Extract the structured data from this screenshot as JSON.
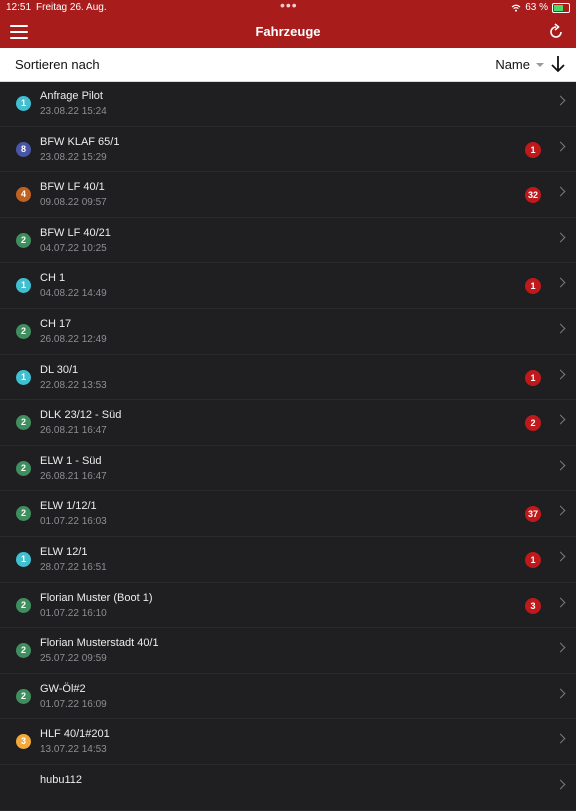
{
  "status": {
    "time": "12:51",
    "date": "Freitag 26. Aug.",
    "battery": "63 %",
    "battery_level": 0.63
  },
  "header": {
    "title": "Fahrzeuge",
    "menu_icon": "hamburger-menu-icon",
    "refresh_icon": "refresh-icon"
  },
  "sort": {
    "label": "Sortieren nach",
    "value": "Name",
    "direction_icon": "arrow-down-icon"
  },
  "colors": {
    "header": "#a81c1c",
    "badge": "#c0191c"
  },
  "vehicles": [
    {
      "count": "1",
      "color": "#3fbfd0",
      "name": "Anfrage Pilot",
      "time": "23.08.22 15:24",
      "badge": ""
    },
    {
      "count": "8",
      "color": "#4a55a8",
      "name": "BFW KLAF 65/1",
      "time": "23.08.22 15:29",
      "badge": "1"
    },
    {
      "count": "4",
      "color": "#c0621e",
      "name": "BFW LF 40/1",
      "time": "09.08.22 09:57",
      "badge": "32"
    },
    {
      "count": "2",
      "color": "#3e8e5e",
      "name": "BFW LF 40/21",
      "time": "04.07.22 10:25",
      "badge": ""
    },
    {
      "count": "1",
      "color": "#3fbfd0",
      "name": "CH 1",
      "time": "04.08.22 14:49",
      "badge": "1"
    },
    {
      "count": "2",
      "color": "#3e8e5e",
      "name": "CH 17",
      "time": "26.08.22 12:49",
      "badge": ""
    },
    {
      "count": "1",
      "color": "#3fbfd0",
      "name": "DL 30/1",
      "time": "22.08.22 13:53",
      "badge": "1"
    },
    {
      "count": "2",
      "color": "#3e8e5e",
      "name": "DLK 23/12 - Süd",
      "time": "26.08.21 16:47",
      "badge": "2"
    },
    {
      "count": "2",
      "color": "#3e8e5e",
      "name": "ELW 1 - Süd",
      "time": "26.08.21 16:47",
      "badge": ""
    },
    {
      "count": "2",
      "color": "#3e8e5e",
      "name": "ELW 1/12/1",
      "time": "01.07.22 16:03",
      "badge": "37"
    },
    {
      "count": "1",
      "color": "#3fbfd0",
      "name": "ELW 12/1",
      "time": "28.07.22 16:51",
      "badge": "1"
    },
    {
      "count": "2",
      "color": "#3e8e5e",
      "name": "Florian Muster (Boot 1)",
      "time": "01.07.22 16:10",
      "badge": "3"
    },
    {
      "count": "2",
      "color": "#3e8e5e",
      "name": "Florian Musterstadt 40/1",
      "time": "25.07.22 09:59",
      "badge": ""
    },
    {
      "count": "2",
      "color": "#3e8e5e",
      "name": "GW-Öl#2",
      "time": "01.07.22 16:09",
      "badge": ""
    },
    {
      "count": "3",
      "color": "#f2a93b",
      "name": "HLF 40/1#201",
      "time": "13.07.22 14:53",
      "badge": ""
    },
    {
      "count": "",
      "color": "#3e8e5e",
      "name": "hubu112",
      "time": "",
      "badge": ""
    }
  ]
}
